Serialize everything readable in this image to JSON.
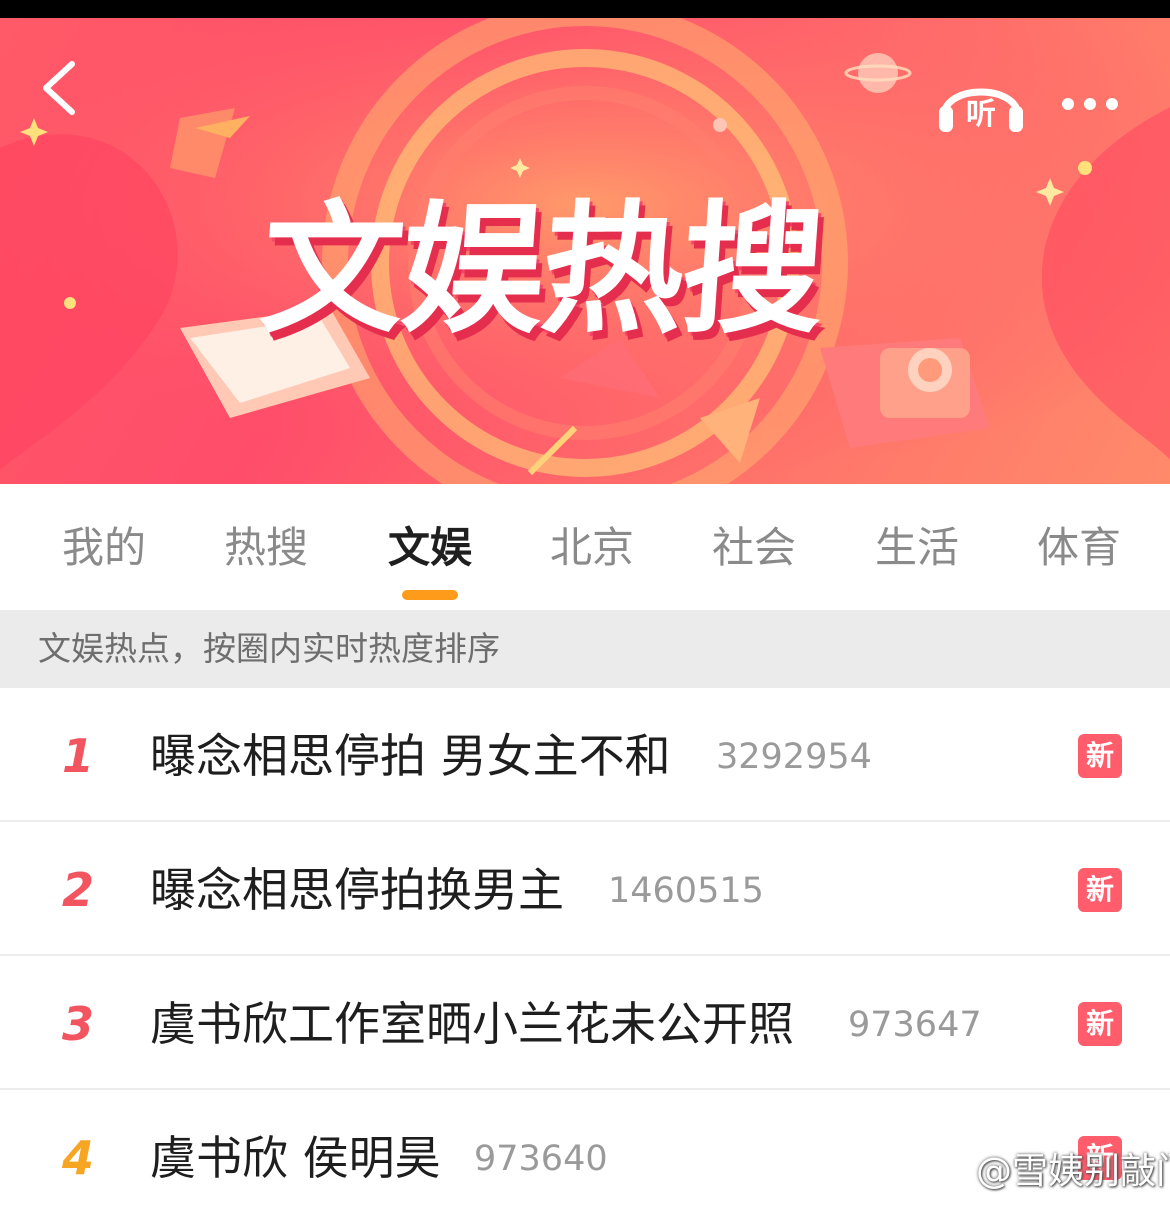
{
  "banner": {
    "title": "文娱热搜",
    "listen_label": "听"
  },
  "tabs": [
    {
      "label": "我的",
      "active": false
    },
    {
      "label": "热搜",
      "active": false
    },
    {
      "label": "文娱",
      "active": true
    },
    {
      "label": "北京",
      "active": false
    },
    {
      "label": "社会",
      "active": false
    },
    {
      "label": "生活",
      "active": false
    },
    {
      "label": "体育",
      "active": false
    }
  ],
  "subheader": "文娱热点，按圈内实时热度排序",
  "items": [
    {
      "rank": "1",
      "title": "曝念相思停拍 男女主不和",
      "count": "3292954",
      "badge": "新"
    },
    {
      "rank": "2",
      "title": "曝念相思停拍换男主",
      "count": "1460515",
      "badge": "新"
    },
    {
      "rank": "3",
      "title": "虞书欣工作室晒小兰花未公开照",
      "count": "973647",
      "badge": "新"
    },
    {
      "rank": "4",
      "title": "虞书欣 侯明昊",
      "count": "973640",
      "badge": "新"
    }
  ],
  "watermark": "@雪姨别敲门",
  "colors": {
    "accent": "#ff9b1a",
    "badge": "#ff5d6c",
    "rank_top": "#f2555f",
    "rank_4": "#f6a623"
  }
}
